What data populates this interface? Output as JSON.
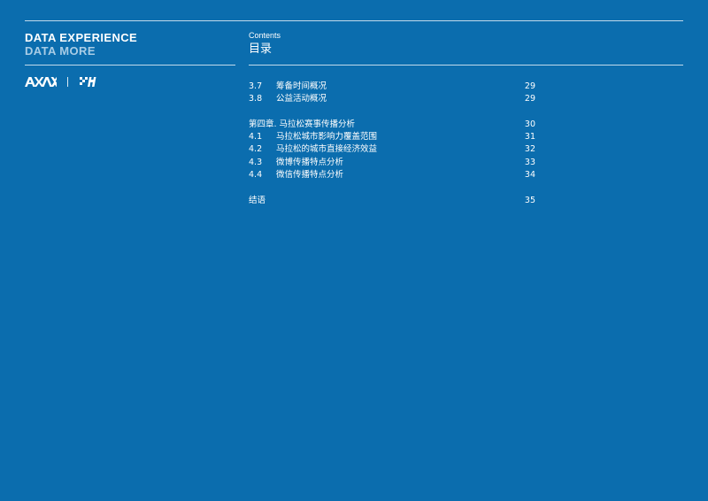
{
  "brand": {
    "line1": "DATA EXPERIENCE",
    "line2": "DATA MORE",
    "logos": [
      "axax-logo-icon",
      "checkered-h-logo-icon"
    ]
  },
  "header": {
    "contents_label": "Contents",
    "title": "目录"
  },
  "toc": {
    "group1": [
      {
        "num": "3.7",
        "title": "筹备时间概况",
        "page": "29"
      },
      {
        "num": "3.8",
        "title": "公益活动概况",
        "page": "29"
      }
    ],
    "chapter4": {
      "title": "第四章. 马拉松赛事传播分析",
      "page": "30"
    },
    "group2": [
      {
        "num": "4.1",
        "title": "马拉松城市影响力覆盖范围",
        "page": "31"
      },
      {
        "num": "4.2",
        "title": "马拉松的城市直接经济效益",
        "page": "32"
      },
      {
        "num": "4.3",
        "title": "微博传播特点分析",
        "page": "33"
      },
      {
        "num": "4.4",
        "title": "微信传播特点分析",
        "page": "34"
      }
    ],
    "conclusion": {
      "title": "结语",
      "page": "35"
    }
  },
  "colors": {
    "background": "#0b6dae",
    "text": "#ffffff",
    "subtitle": "#a9cde6"
  }
}
